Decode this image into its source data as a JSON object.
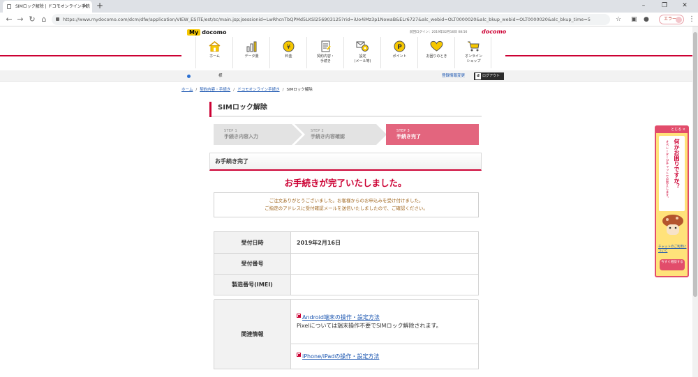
{
  "browser": {
    "tab_title": "SIMロック解除 | ドコモオンライン手続",
    "tab_close": "×",
    "new_tab": "+",
    "url": "https://www.mydocomo.com/dcm/dfw/application/VIEW_ESITE/est/sc/main.jsp;jsessionid=LwRhcnTbQPMd5LKSl256903125?rid=iUo4iMz3p1NowaB&ELr6727&alc_webid=OLT0000020&alc_bkup_webid=OLT0000020&alc_bkup_time=5",
    "profile_label": "エラー",
    "win_min": "–",
    "win_max": "❐",
    "win_close": "✕"
  },
  "header": {
    "logo_my": "My",
    "logo_docomo": "docomo",
    "last_login": "前回ログイン：2019年02月16日 08:56",
    "brand": "docomo"
  },
  "gnav": [
    {
      "label": "ホーム",
      "icon": "home-icon"
    },
    {
      "label": "データ量",
      "icon": "bar-chart-icon"
    },
    {
      "label": "料金",
      "icon": "yen-icon"
    },
    {
      "label": "契約内容・\n手続き",
      "icon": "document-icon"
    },
    {
      "label": "設定\n(メール等)",
      "icon": "gear-mail-icon"
    },
    {
      "label": "ポイント",
      "icon": "point-icon"
    },
    {
      "label": "お困りのとき",
      "icon": "heart-icon"
    },
    {
      "label": "オンライン\nショップ",
      "icon": "cart-icon"
    }
  ],
  "userbar": {
    "name": "様",
    "reg_change": "登録情報変更",
    "logout_d": "d",
    "logout": "ログアウト"
  },
  "breadcrumb": {
    "home": "ホーム",
    "contract": "契約内容・手続き",
    "online": "ドコモオンライン手続き",
    "current": "SIMロック解除",
    "sep": "/"
  },
  "page_title": "SIMロック解除",
  "steps": [
    {
      "num": "STEP 1",
      "name": "手続き内容入力"
    },
    {
      "num": "STEP 2",
      "name": "手続き内容確認"
    },
    {
      "num": "STEP 3",
      "name": "手続き完了"
    }
  ],
  "section_title": "お手続き完了",
  "done_message": "お手続きが完了いたしました。",
  "notice": {
    "line1": "ご注文ありがとうございました。お客様からのお申込みを受け付けました。",
    "line2": "ご指定のアドレスに受付確認メールを送信いたしましたので、ご確認ください。"
  },
  "table": {
    "rows": [
      {
        "label": "受付日時",
        "value": "2019年2月16日"
      },
      {
        "label": "受付番号",
        "value": ""
      },
      {
        "label": "製造番号(IMEI)",
        "value": ""
      }
    ],
    "related_label": "関連情報",
    "android_link": "Android端末の操作・設定方法",
    "pixel_note": "Pixelについては端末操作不要でSIMロック解除されます。",
    "iphone_link": "iPhone/iPadの操作・設定方法"
  },
  "chat": {
    "close": "とじる ×",
    "question": "何かお困りですか？",
    "sub": "オペレーターがチャットでお答えします。",
    "link": "チャットのご利用について",
    "button": "今すぐ相談する"
  },
  "colors": {
    "docomo_red": "#cc0033",
    "step_active": "#e3657e",
    "notice_text": "#a0661e",
    "link": "#1a55b0"
  }
}
